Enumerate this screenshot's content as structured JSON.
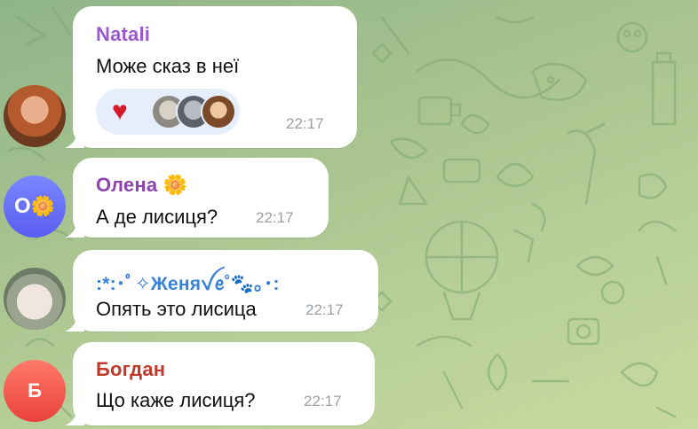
{
  "messages": [
    {
      "sender": "Natali",
      "sender_color": "#9b59d0",
      "text": "Може сказ в неї",
      "time": "22:17",
      "reactions": {
        "emoji": "♥",
        "count_avatars": 3
      }
    },
    {
      "sender": "Олена",
      "sender_color": "#8e44ad",
      "sender_emoji": "🌼",
      "text": "А де лисиця?",
      "time": "22:17",
      "avatar_letter": "О",
      "avatar_emoji": "🌼"
    },
    {
      "sender": ":*:･ﾟ✧Женяꪜꫀ˚🐾｡･:",
      "sender_color": "#3b82d6",
      "text": "Опять это лисица",
      "time": "22:17"
    },
    {
      "sender": "Богдан",
      "sender_color": "#c0392b",
      "text": "Що каже лисиця?",
      "time": "22:17",
      "avatar_letter": "Б"
    }
  ]
}
